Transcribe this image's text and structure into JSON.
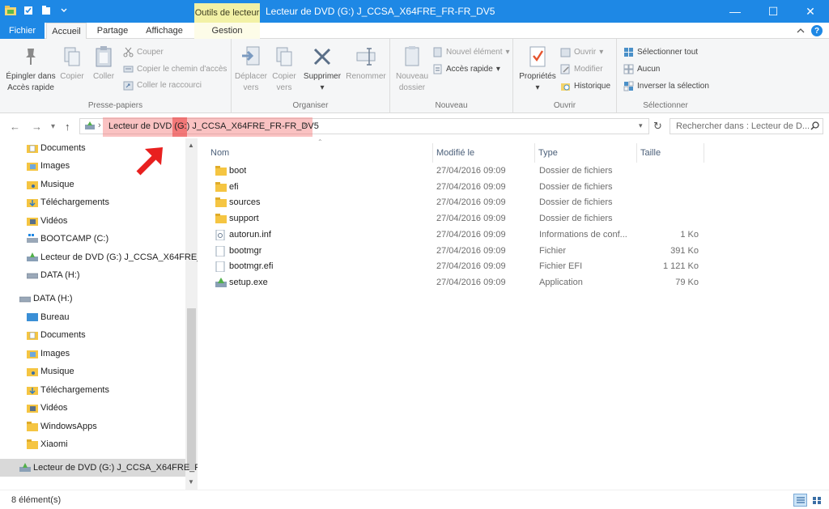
{
  "window": {
    "title": "Lecteur de DVD (G:) J_CCSA_X64FRE_FR-FR_DV5",
    "context_tab": "Outils de lecteur",
    "minimize_glyph": "—",
    "maximize_glyph": "☐",
    "close_glyph": "✕"
  },
  "quick_access": [
    "properties-icon",
    "new-folder-icon",
    "dropdown-icon"
  ],
  "ribbon_tabs": [
    {
      "label": "Fichier",
      "active": false
    },
    {
      "label": "Accueil",
      "active": true
    },
    {
      "label": "Partage",
      "active": false
    },
    {
      "label": "Affichage",
      "active": false
    },
    {
      "label": "Gestion",
      "active": false
    }
  ],
  "ribbon": {
    "groups": {
      "clipboard": "Presse-papiers",
      "organize": "Organiser",
      "new": "Nouveau",
      "open": "Ouvrir",
      "select": "Sélectionner"
    },
    "pin_line1": "Épingler dans",
    "pin_line2": "Accès rapide",
    "copy": "Copier",
    "paste": "Coller",
    "cut": "Couper",
    "copy_path": "Copier le chemin d'accès",
    "paste_shortcut": "Coller le raccourci",
    "move_line1": "Déplacer",
    "move_line2": "vers",
    "copyto_line1": "Copier",
    "copyto_line2": "vers",
    "delete": "Supprimer",
    "rename": "Renommer",
    "newfolder_line1": "Nouveau",
    "newfolder_line2": "dossier",
    "new_item": "Nouvel élément",
    "quick_access": "Accès rapide",
    "properties": "Propriétés",
    "open": "Ouvrir",
    "edit": "Modifier",
    "history": "Historique",
    "select_all": "Sélectionner tout",
    "select_none": "Aucun",
    "invert_selection": "Inverser la sélection"
  },
  "address": {
    "path": "Lecteur de DVD (G:) J_CCSA_X64FRE_FR-FR_DV5",
    "search_placeholder": "Rechercher dans : Lecteur de D..."
  },
  "nav_pane": [
    {
      "label": "Documents",
      "icon": "documents-folder-icon"
    },
    {
      "label": "Images",
      "icon": "images-folder-icon"
    },
    {
      "label": "Musique",
      "icon": "music-folder-icon"
    },
    {
      "label": "Téléchargements",
      "icon": "downloads-folder-icon"
    },
    {
      "label": "Vidéos",
      "icon": "videos-folder-icon"
    },
    {
      "label": "BOOTCAMP (C:)",
      "icon": "windows-drive-icon"
    },
    {
      "label": "Lecteur de DVD (G:) J_CCSA_X64FRE_F",
      "icon": "dvd-drive-icon"
    },
    {
      "label": "DATA (H:)",
      "icon": "drive-icon"
    },
    {
      "label": "DATA (H:)",
      "icon": "drive-icon"
    },
    {
      "label": "Bureau",
      "icon": "desktop-folder-icon"
    },
    {
      "label": "Documents",
      "icon": "documents-folder-icon"
    },
    {
      "label": "Images",
      "icon": "images-folder-icon"
    },
    {
      "label": "Musique",
      "icon": "music-folder-icon"
    },
    {
      "label": "Téléchargements",
      "icon": "downloads-folder-icon"
    },
    {
      "label": "Vidéos",
      "icon": "videos-folder-icon"
    },
    {
      "label": "WindowsApps",
      "icon": "folder-icon"
    },
    {
      "label": "Xiaomi",
      "icon": "folder-icon"
    },
    {
      "label": "Lecteur de DVD (G:) J_CCSA_X64FRE_F",
      "icon": "dvd-drive-icon"
    }
  ],
  "columns": {
    "name": "Nom",
    "modified": "Modifié le",
    "type": "Type",
    "size": "Taille"
  },
  "files": [
    {
      "name": "boot",
      "modified": "27/04/2016 09:09",
      "type": "Dossier de fichiers",
      "size": "",
      "icon": "folder-icon"
    },
    {
      "name": "efi",
      "modified": "27/04/2016 09:09",
      "type": "Dossier de fichiers",
      "size": "",
      "icon": "folder-icon"
    },
    {
      "name": "sources",
      "modified": "27/04/2016 09:09",
      "type": "Dossier de fichiers",
      "size": "",
      "icon": "folder-icon"
    },
    {
      "name": "support",
      "modified": "27/04/2016 09:09",
      "type": "Dossier de fichiers",
      "size": "",
      "icon": "folder-icon"
    },
    {
      "name": "autorun.inf",
      "modified": "27/04/2016 09:09",
      "type": "Informations de conf...",
      "size": "1 Ko",
      "icon": "settings-file-icon"
    },
    {
      "name": "bootmgr",
      "modified": "27/04/2016 09:09",
      "type": "Fichier",
      "size": "391 Ko",
      "icon": "file-icon"
    },
    {
      "name": "bootmgr.efi",
      "modified": "27/04/2016 09:09",
      "type": "Fichier EFI",
      "size": "1 121 Ko",
      "icon": "file-icon"
    },
    {
      "name": "setup.exe",
      "modified": "27/04/2016 09:09",
      "type": "Application",
      "size": "79 Ko",
      "icon": "setup-app-icon"
    }
  ],
  "status": {
    "count": "8 élément(s)"
  },
  "colors": {
    "accent": "#1e88e5",
    "context_tab": "#f2f1a6",
    "highlight": "#f47878",
    "annotation_arrow": "#e8201f"
  }
}
